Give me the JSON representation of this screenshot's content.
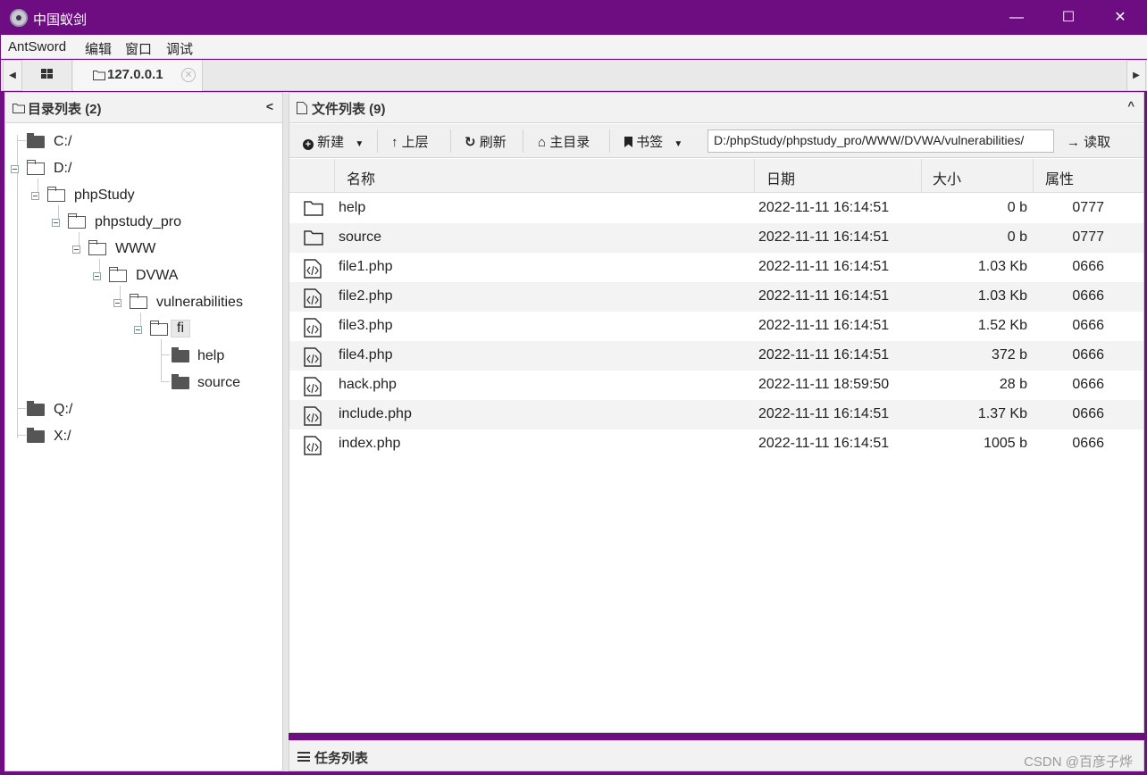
{
  "window": {
    "title": "中国蚁剑",
    "minimize": "—",
    "maximize": "☐",
    "close": "✕"
  },
  "menubar": [
    "AntSword",
    "编辑",
    "窗口",
    "调试"
  ],
  "tabs": {
    "left_arrow": "◀",
    "right_arrow": "▶",
    "host": "127.0.0.1",
    "close": "✕"
  },
  "left_panel": {
    "header": "目录列表 (2)",
    "collapse": "<",
    "tree": [
      "C:/",
      "D:/",
      "phpStudy",
      "phpstudy_pro",
      "WWW",
      "DVWA",
      "vulnerabilities",
      "fi",
      "help",
      "source",
      "Q:/",
      "X:/"
    ]
  },
  "right_panel": {
    "header": "文件列表 (9)",
    "collapse": "^",
    "toolbar": {
      "new": "新建",
      "up": "上层",
      "refresh": "刷新",
      "home": "主目录",
      "bookmark": "书签",
      "path": "D:/phpStudy/phpstudy_pro/WWW/DVWA/vulnerabilities/",
      "read": "读取"
    },
    "columns": [
      "名称",
      "日期",
      "大小",
      "属性"
    ],
    "files": [
      {
        "type": "folder",
        "name": "help",
        "date": "2022-11-11 16:14:51",
        "size": "0 b",
        "perm": "0777"
      },
      {
        "type": "folder",
        "name": "source",
        "date": "2022-11-11 16:14:51",
        "size": "0 b",
        "perm": "0777"
      },
      {
        "type": "php",
        "name": "file1.php",
        "date": "2022-11-11 16:14:51",
        "size": "1.03 Kb",
        "perm": "0666"
      },
      {
        "type": "php",
        "name": "file2.php",
        "date": "2022-11-11 16:14:51",
        "size": "1.03 Kb",
        "perm": "0666"
      },
      {
        "type": "php",
        "name": "file3.php",
        "date": "2022-11-11 16:14:51",
        "size": "1.52 Kb",
        "perm": "0666"
      },
      {
        "type": "php",
        "name": "file4.php",
        "date": "2022-11-11 16:14:51",
        "size": "372 b",
        "perm": "0666"
      },
      {
        "type": "php",
        "name": "hack.php",
        "date": "2022-11-11 18:59:50",
        "size": "28 b",
        "perm": "0666"
      },
      {
        "type": "php",
        "name": "include.php",
        "date": "2022-11-11 16:14:51",
        "size": "1.37 Kb",
        "perm": "0666"
      },
      {
        "type": "php",
        "name": "index.php",
        "date": "2022-11-11 16:14:51",
        "size": "1005 b",
        "perm": "0666"
      }
    ]
  },
  "taskbar": {
    "label": "任务列表",
    "watermark": "CSDN @百彦子烨"
  }
}
